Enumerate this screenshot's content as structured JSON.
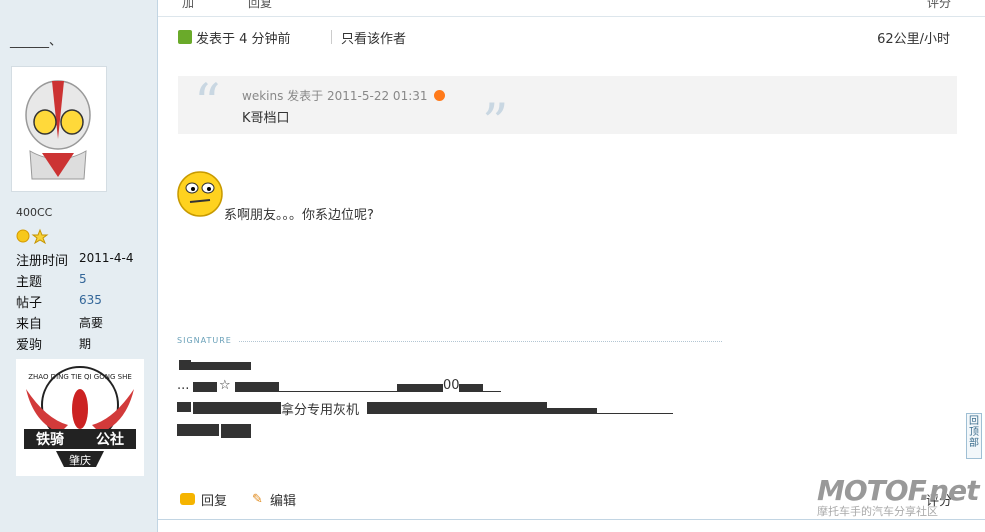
{
  "top_strip": {
    "left_items": [
      "加",
      "回复"
    ],
    "right_text": "评分"
  },
  "author": {
    "username": "______、",
    "level": "400CC",
    "stats": [
      {
        "label": "注册时间",
        "value": "2011-4-4",
        "link": false
      },
      {
        "label": "主题",
        "value": "5",
        "link": true
      },
      {
        "label": "帖子",
        "value": "635",
        "link": true
      },
      {
        "label": "来自",
        "value": "高要",
        "link": false
      },
      {
        "label": "爱驹",
        "value": "期",
        "link": false
      }
    ],
    "badge": {
      "arc_text": "ZHAO DING TIE QI GONG SHE",
      "name_left": "铁骑",
      "name_right": "公社",
      "city": "肇庆"
    }
  },
  "post": {
    "posted": "发表于 4 分钟前",
    "only_author": "只看该作者",
    "speed": "62公里/小时",
    "quote": {
      "author": "wekins",
      "posted_label": "发表于",
      "time": "2011-5-22 01:31",
      "text": "K哥档口"
    },
    "message": "系啊朋友。。。你系边位呢?",
    "signature_label": "SIGNATURE",
    "signature": {
      "line2_prefix": "...",
      "line2_star": "☆",
      "line2_num": "00",
      "line3_text": "拿分专用灰机"
    }
  },
  "actions": {
    "reply": "回复",
    "edit": "编辑",
    "rate": "评分"
  },
  "back_to_top": "回顶部",
  "watermark": {
    "logo": "MOTOF.net",
    "tagline": "摩托车手的汽车分享社区"
  }
}
